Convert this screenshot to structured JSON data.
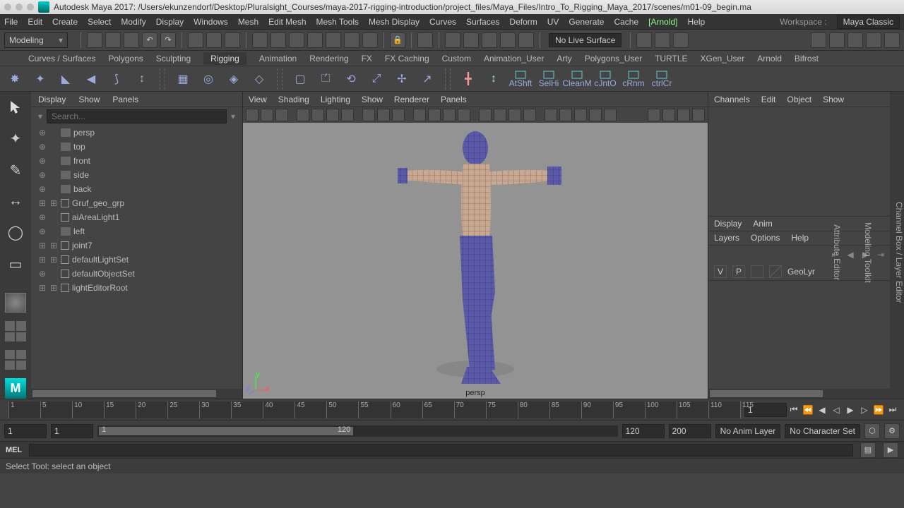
{
  "title": "Autodesk Maya 2017: /Users/ekunzendorf/Desktop/Pluralsight_Courses/maya-2017-rigging-introduction/project_files/Maya_Files/Intro_To_Rigging_Maya_2017/scenes/m01-09_begin.ma",
  "menubar": {
    "items": [
      "File",
      "Edit",
      "Create",
      "Select",
      "Modify",
      "Display",
      "Windows",
      "Mesh",
      "Edit Mesh",
      "Mesh Tools",
      "Mesh Display",
      "Curves",
      "Surfaces",
      "Deform",
      "UV",
      "Generate",
      "Cache"
    ],
    "arnold": "[Arnold]",
    "help": "Help",
    "workspace_label": "Workspace :",
    "workspace_value": "Maya Classic"
  },
  "mode": "Modeling",
  "live_surface": "No Live Surface",
  "shelf_tabs": [
    "Curves / Surfaces",
    "Polygons",
    "Sculpting",
    "Rigging",
    "Animation",
    "Rendering",
    "FX",
    "FX Caching",
    "Custom",
    "Animation_User",
    "Arty",
    "Polygons_User",
    "TURTLE",
    "XGen_User",
    "Arnold",
    "Bifrost"
  ],
  "shelf_active": 3,
  "shelf_labeled": [
    "AtShft",
    "SelHi",
    "CleanM",
    "cJntO",
    "cRnm",
    "ctrlCr"
  ],
  "outliner": {
    "menu": [
      "Display",
      "Show",
      "Panels"
    ],
    "search_placeholder": "Search...",
    "items": [
      {
        "name": "persp",
        "kind": "camera",
        "indent": 1
      },
      {
        "name": "top",
        "kind": "camera",
        "indent": 1
      },
      {
        "name": "front",
        "kind": "camera",
        "indent": 1
      },
      {
        "name": "side",
        "kind": "camera",
        "indent": 1
      },
      {
        "name": "back",
        "kind": "camera",
        "indent": 1
      },
      {
        "name": "Gruf_geo_grp",
        "kind": "group",
        "indent": 1,
        "expandable": true
      },
      {
        "name": "aiAreaLight1",
        "kind": "light",
        "indent": 1
      },
      {
        "name": "left",
        "kind": "camera",
        "indent": 1
      },
      {
        "name": "joint7",
        "kind": "joint",
        "indent": 1,
        "expandable": true
      },
      {
        "name": "defaultLightSet",
        "kind": "set",
        "indent": 1,
        "expandable": true
      },
      {
        "name": "defaultObjectSet",
        "kind": "set",
        "indent": 1
      },
      {
        "name": "lightEditorRoot",
        "kind": "set",
        "indent": 1,
        "expandable": true
      }
    ]
  },
  "viewport": {
    "menu": [
      "View",
      "Shading",
      "Lighting",
      "Show",
      "Renderer",
      "Panels"
    ],
    "camera_label": "persp"
  },
  "channel_box": {
    "menu": [
      "Channels",
      "Edit",
      "Object",
      "Show"
    ]
  },
  "layer_editor": {
    "tabs1": [
      "Display",
      "Anim"
    ],
    "tabs2": [
      "Layers",
      "Options",
      "Help"
    ],
    "v_label": "V",
    "p_label": "P",
    "layer_name": "GeoLyr"
  },
  "right_dock": [
    "Channel Box / Layer Editor",
    "Modeling Toolkit",
    "Attribute Editor"
  ],
  "timeline": {
    "ticks": [
      "1",
      "5",
      "10",
      "15",
      "20",
      "25",
      "30",
      "35",
      "40",
      "45",
      "50",
      "55",
      "60",
      "65",
      "70",
      "75",
      "80",
      "85",
      "90",
      "95",
      "100",
      "105",
      "110",
      "115",
      "1"
    ],
    "current": "1"
  },
  "range": {
    "start_out": "1",
    "start_in": "1",
    "start_slider": "1",
    "end_slider": "120",
    "end_in": "120",
    "end_out": "200",
    "anim_layer": "No Anim Layer",
    "char_set": "No Character Set"
  },
  "cmd": {
    "lang": "MEL"
  },
  "status": "Select Tool: select an object"
}
